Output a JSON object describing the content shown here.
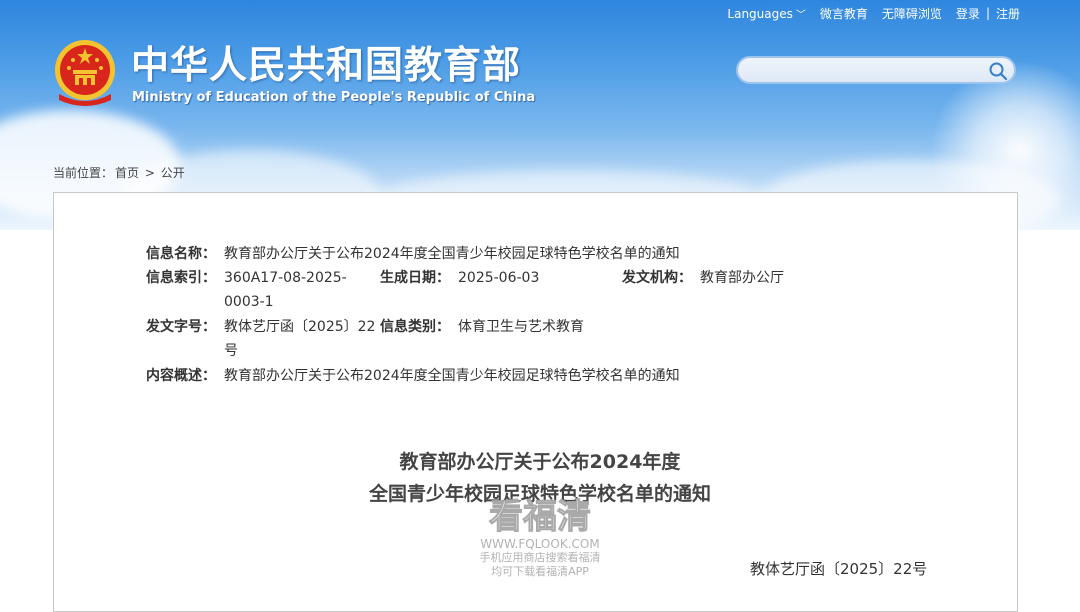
{
  "header": {
    "site_title": "中华人民共和国教育部",
    "site_subtitle": "Ministry of Education of the People's Republic of China",
    "emblem_icon": "national-emblem-icon"
  },
  "topnav": {
    "languages": "Languages",
    "weixin": "微言教育",
    "accessibility": "无障碍浏览",
    "login": "登录",
    "separator": "|",
    "register": "注册"
  },
  "search": {
    "placeholder": "",
    "icon": "search-icon"
  },
  "breadcrumb": {
    "prefix": "当前位置：",
    "home": "首页",
    "sep": ">",
    "current": "公开"
  },
  "meta": {
    "name_label": "信息名称：",
    "name_value": "教育部办公厅关于公布2024年度全国青少年校园足球特色学校名单的通知",
    "index_label": "信息索引：",
    "index_value_1": "360A17-08-2025-",
    "index_value_2": "0003-1",
    "date_label": "生成日期：",
    "date_value": "2025-06-03",
    "org_label": "发文机构：",
    "org_value": "教育部办公厅",
    "docno_label": "发文字号：",
    "docno_value_1": "教体艺厅函〔2025〕22",
    "docno_value_2": "号",
    "category_label": "信息类别：",
    "category_value": "体育卫生与艺术教育",
    "summary_label": "内容概述：",
    "summary_value": "教育部办公厅关于公布2024年度全国青少年校园足球特色学校名单的通知"
  },
  "document": {
    "title_line1": "教育部办公厅关于公布2024年度",
    "title_line2": "全国青少年校园足球特色学校名单的通知",
    "doc_number": "教体艺厅函〔2025〕22号"
  },
  "watermark": {
    "big": "看福清",
    "url": "WWW.FQLOOK.COM",
    "line1": "手机应用商店搜索看福清",
    "line2": "均可下载看福清APP"
  },
  "colors": {
    "sky_top": "#2f86de",
    "sky_bottom": "#eef6fd",
    "emblem_red": "#d8261c",
    "emblem_gold": "#f4c430"
  }
}
